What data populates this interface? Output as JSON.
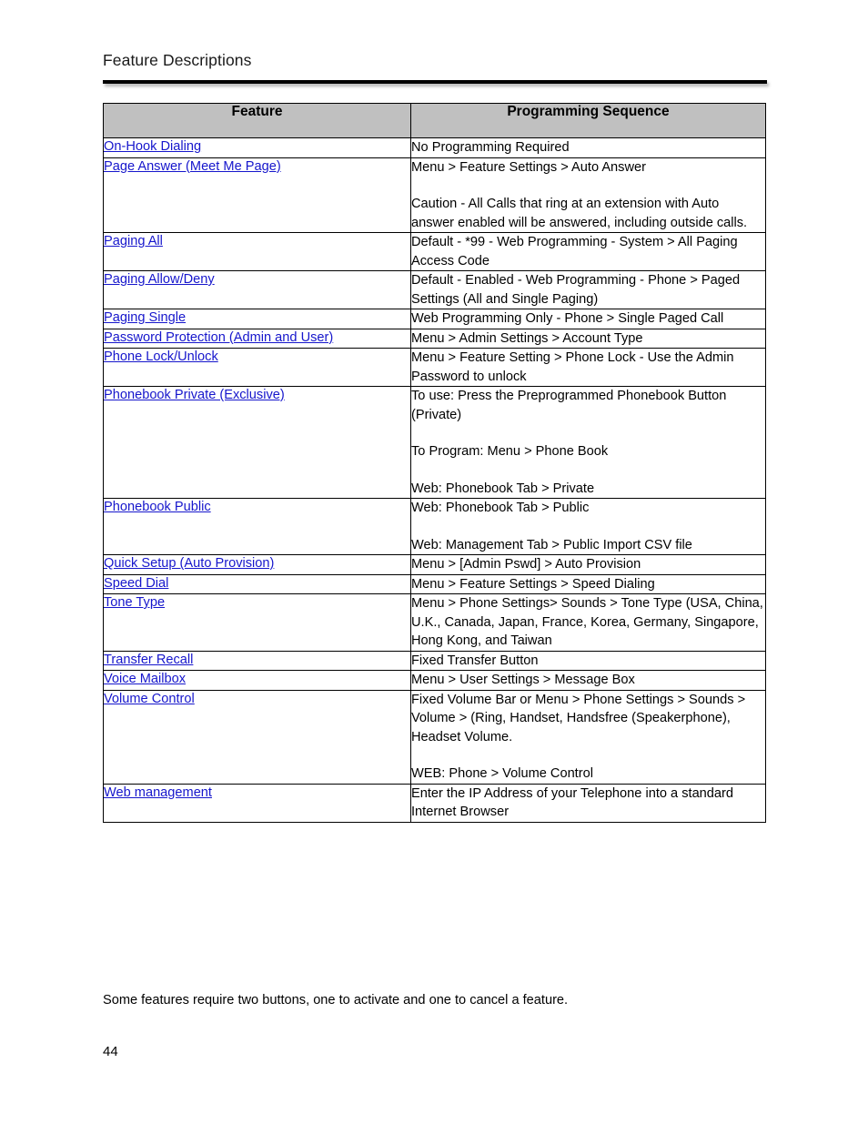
{
  "document": {
    "title": "Feature Descriptions",
    "footnote": "Some features require two buttons, one to activate and one to cancel a feature.",
    "page_number": "44"
  },
  "table": {
    "headers": {
      "feature": "Feature",
      "sequence": "Programming Sequence"
    },
    "header_background": "#c0c0c0",
    "link_color": "#1616cc",
    "rows": [
      {
        "feature": "On-Hook Dialing",
        "sequence": [
          "No Programming Required"
        ]
      },
      {
        "feature": "Page Answer (Meet Me Page)",
        "sequence": [
          "Menu > Feature Settings > Auto Answer",
          "Caution - All Calls that ring at an extension with Auto answer enabled will be answered, including outside calls."
        ]
      },
      {
        "feature": "Paging All",
        "sequence": [
          "Default - *99 - Web Programming - System > All Paging Access Code"
        ]
      },
      {
        "feature": "Paging Allow/Deny",
        "sequence": [
          "Default - Enabled - Web Programming - Phone > Paged Settings (All and Single Paging)"
        ]
      },
      {
        "feature": "Paging Single",
        "sequence": [
          "Web Programming Only - Phone > Single Paged Call"
        ]
      },
      {
        "feature": "Password Protection (Admin and User)",
        "sequence": [
          "Menu > Admin Settings > Account Type"
        ]
      },
      {
        "feature": "Phone Lock/Unlock",
        "sequence": [
          "Menu > Feature Setting > Phone Lock - Use the Admin Password to unlock"
        ]
      },
      {
        "feature": "Phonebook Private (Exclusive)",
        "sequence": [
          "To use: Press the Preprogrammed Phonebook Button (Private)",
          "To Program:  Menu > Phone Book",
          "Web: Phonebook Tab > Private"
        ]
      },
      {
        "feature": "Phonebook Public",
        "sequence": [
          "Web: Phonebook Tab > Public",
          "Web: Management Tab > Public Import CSV file"
        ]
      },
      {
        "feature": "Quick Setup (Auto Provision)",
        "sequence": [
          "Menu > [Admin Pswd] > Auto Provision"
        ]
      },
      {
        "feature": "Speed Dial",
        "sequence": [
          "Menu > Feature Settings > Speed Dialing"
        ]
      },
      {
        "feature": "Tone Type",
        "sequence": [
          "Menu > Phone Settings> Sounds > Tone Type (USA, China, U.K., Canada, Japan, France, Korea, Germany, Singapore, Hong Kong, and Taiwan"
        ]
      },
      {
        "feature": "Transfer Recall",
        "sequence": [
          "Fixed Transfer Button"
        ]
      },
      {
        "feature": "Voice Mailbox",
        "sequence": [
          "Menu > User Settings > Message Box"
        ]
      },
      {
        "feature": "Volume Control",
        "sequence": [
          "Fixed Volume Bar or Menu > Phone Settings > Sounds > Volume > (Ring, Handset, Handsfree (Speakerphone), Headset Volume.",
          "WEB: Phone > Volume Control"
        ]
      },
      {
        "feature": "Web management",
        "sequence": [
          "Enter the IP Address of your Telephone into a standard Internet Browser"
        ]
      }
    ]
  }
}
